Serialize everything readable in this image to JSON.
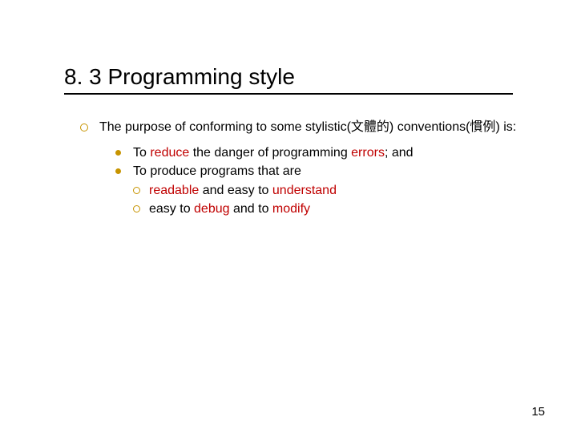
{
  "title": "8. 3 Programming style",
  "purpose": {
    "prefix": "The purpose of conforming to some stylistic(",
    "cjk1": "文體的",
    "mid": ") conventions(",
    "cjk2": "慣例",
    "suffix": ") is:"
  },
  "b1": {
    "t1": "To ",
    "r1": "reduce",
    "t2": " the danger of programming ",
    "r2": "errors",
    "t3": "; and"
  },
  "b2": "To produce programs that are",
  "s1": {
    "r1": "readable",
    "t1": " and easy to ",
    "r2": "understand"
  },
  "s2": {
    "t1": "easy to ",
    "r1": "debug",
    "t2": " and to ",
    "r2": "modify"
  },
  "page": "15"
}
